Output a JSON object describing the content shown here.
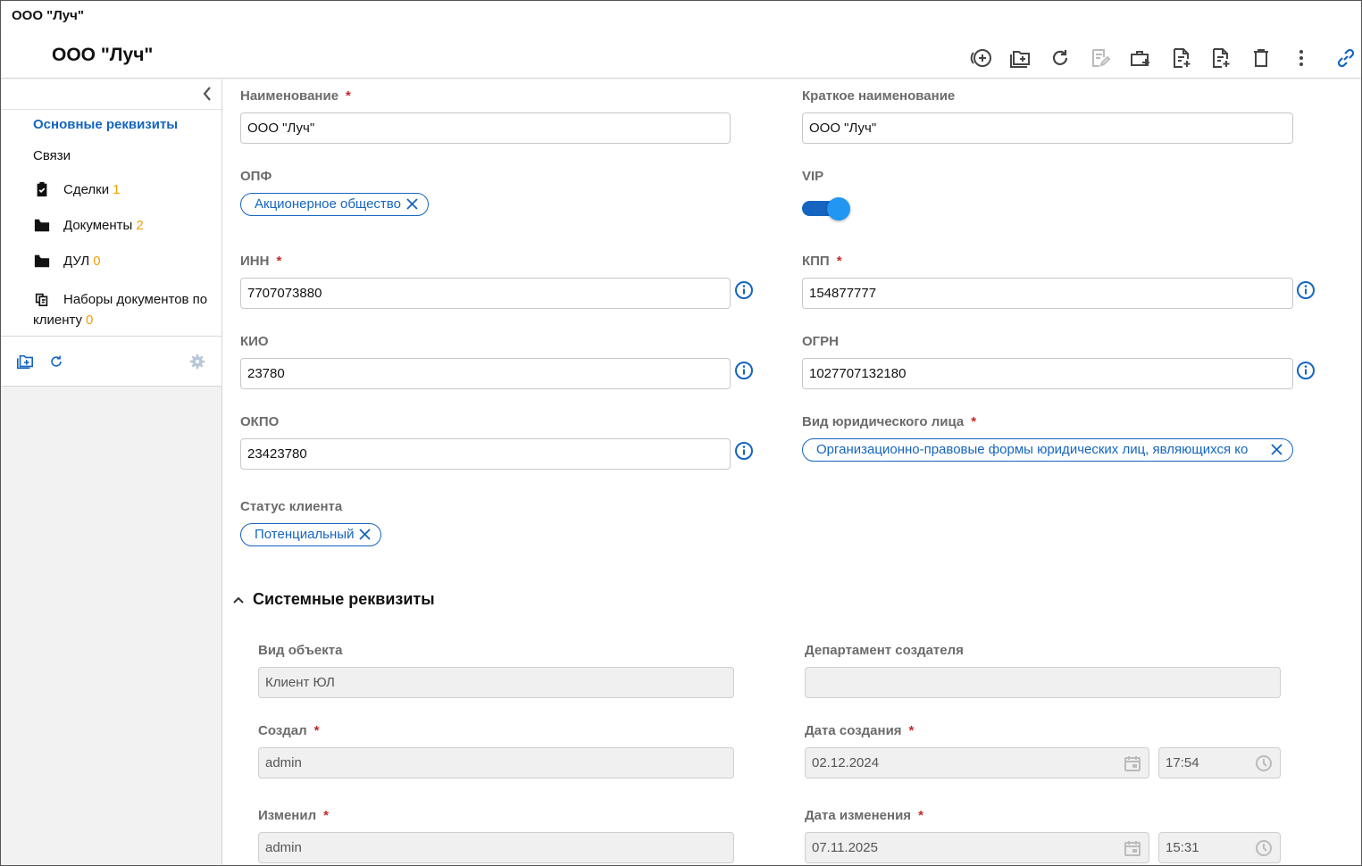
{
  "window": {
    "title": "ООО \"Луч\""
  },
  "header": {
    "title": "ООО \"Луч\""
  },
  "toolbar": {
    "icons": [
      "add-circle-icon",
      "folder-add-icon",
      "refresh-icon",
      "edit-document-icon",
      "briefcase-add-icon",
      "document-add-icon",
      "document-add-alt-icon",
      "trash-icon",
      "more-vertical-icon",
      "link-icon"
    ]
  },
  "sidebar": {
    "items": [
      {
        "label": "Основные реквизиты",
        "active": true
      },
      {
        "label": "Связи"
      },
      {
        "label": "Сделки",
        "count": "1",
        "icon": "clipboard-check-icon"
      },
      {
        "label": "Документы",
        "count": "2",
        "icon": "folder-icon"
      },
      {
        "label": "ДУЛ",
        "count": "0",
        "icon": "folder-icon"
      },
      {
        "label": "Наборы документов по",
        "label2": "клиенту",
        "count": "0",
        "icon": "document-set-icon"
      }
    ],
    "tools": [
      "folder-add-icon",
      "refresh-icon",
      "settings-gear-icon"
    ]
  },
  "form": {
    "name": {
      "label": "Наименование",
      "value": "ООО \"Луч\""
    },
    "short_name": {
      "label": "Краткое наименование",
      "value": "ООО \"Луч\""
    },
    "opf": {
      "label": "ОПФ",
      "chip": "Акционерное общество"
    },
    "vip": {
      "label": "VIP",
      "on": true
    },
    "inn": {
      "label": "ИНН",
      "value": "7707073880"
    },
    "kpp": {
      "label": "КПП",
      "value": "154877777"
    },
    "kio": {
      "label": "КИО",
      "value": "23780"
    },
    "ogrn": {
      "label": "ОГРН",
      "value": "1027707132180"
    },
    "okpo": {
      "label": "ОКПО",
      "value": "23423780"
    },
    "legal_type": {
      "label": "Вид юридического лица",
      "chip": "Организационно-правовые формы юридических лиц, являющихся ко"
    },
    "client_status": {
      "label": "Статус клиента",
      "chip": "Потенциальный"
    },
    "required_mark": "*"
  },
  "system": {
    "title": "Системные реквизиты",
    "object_type": {
      "label": "Вид объекта",
      "value": "Клиент ЮЛ"
    },
    "creator_dept": {
      "label": "Департамент создателя",
      "value": ""
    },
    "created_by": {
      "label": "Создал",
      "value": "admin"
    },
    "created_at": {
      "label": "Дата создания",
      "date": "02.12.2024",
      "time": "17:54"
    },
    "modified_by": {
      "label": "Изменил",
      "value": "admin"
    },
    "modified_at": {
      "label": "Дата изменения",
      "date": "07.11.2025",
      "time": "15:31"
    }
  },
  "colors": {
    "accent": "#1565c0",
    "count": "#f0a000",
    "required": "#c62828",
    "toggle": "#2196f3"
  }
}
